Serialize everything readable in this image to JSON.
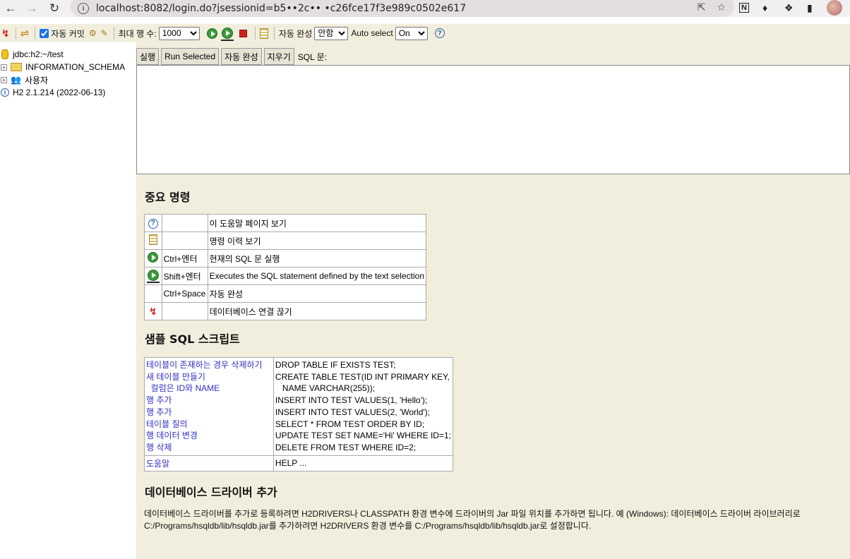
{
  "browser": {
    "url": "localhost:8082/login.do?jsessionid=b5••2c•• •c26fce17f3e989c0502e617"
  },
  "toolbar": {
    "auto_commit_label": "자동 커밋",
    "max_rows_label": "최대 행 수:",
    "max_rows_value": "1000",
    "autocomplete_label": "자동 완성",
    "autocomplete_value": "안함",
    "autoselect_label": "Auto select",
    "autoselect_value": "On"
  },
  "tree": {
    "connection": "jdbc:h2:~/test",
    "schema": "INFORMATION_SCHEMA",
    "users": "사용자",
    "version": "H2 2.1.214 (2022-06-13)"
  },
  "sqlbar": {
    "run": "실행",
    "run_selected": "Run Selected",
    "auto_complete": "자동 완성",
    "clear": "지우기",
    "sql_label": "SQL 문:"
  },
  "help": {
    "important_title": "중요 명령",
    "commands": [
      {
        "icon": "help-icon",
        "key": "",
        "desc": "이 도움말 페이지 보기"
      },
      {
        "icon": "history-icon",
        "key": "",
        "desc": "명령 이력 보기"
      },
      {
        "icon": "run-icon",
        "key": "Ctrl+엔터",
        "desc": "현재의 SQL 문 실행"
      },
      {
        "icon": "run-selected-icon",
        "key": "Shift+엔터",
        "desc": "Executes the SQL statement defined by the text selection"
      },
      {
        "icon": "",
        "key": "Ctrl+Space",
        "desc": "자동 완성"
      },
      {
        "icon": "disconnect-icon",
        "key": "",
        "desc": "데이터베이스 연결 끊기"
      }
    ],
    "sample_title": "샘플 SQL 스크립트",
    "samples": [
      {
        "label": "테이블이 존재하는 경우 삭제하기",
        "sql": "DROP TABLE IF EXISTS TEST;"
      },
      {
        "label": "새 테이블 만들기",
        "sql": "CREATE TABLE TEST(ID INT PRIMARY KEY,"
      },
      {
        "label": "  컬럼은 ID와 NAME",
        "sql": "   NAME VARCHAR(255));"
      },
      {
        "label": "행 추가",
        "sql": "INSERT INTO TEST VALUES(1, 'Hello');"
      },
      {
        "label": "행 추가",
        "sql": "INSERT INTO TEST VALUES(2, 'World');"
      },
      {
        "label": "테이블 질의",
        "sql": "SELECT * FROM TEST ORDER BY ID;"
      },
      {
        "label": "행 데이터 변경",
        "sql": "UPDATE TEST SET NAME='Hi' WHERE ID=1;"
      },
      {
        "label": "행 삭제",
        "sql": "DELETE FROM TEST WHERE ID=2;"
      }
    ],
    "help_row": {
      "label": "도움말",
      "sql": "HELP ..."
    },
    "driver_title": "데이터베이스 드라이버 추가",
    "driver_text_1": "데이터베이스 드라이버를 추가로 등록하려면 H2DRIVERS나 CLASSPATH 환경 변수에 드라이버의 Jar 파일 위치를 추가하면 됩니다. 예 (Windows): 데이터베이스 드라이버 라이브러리로",
    "driver_text_2": "C:/Programs/hsqldb/lib/hsqldb.jar를 추가하려면 H2DRIVERS 환경 변수를 C:/Programs/hsqldb/lib/hsqldb.jar로 설정합니다."
  }
}
